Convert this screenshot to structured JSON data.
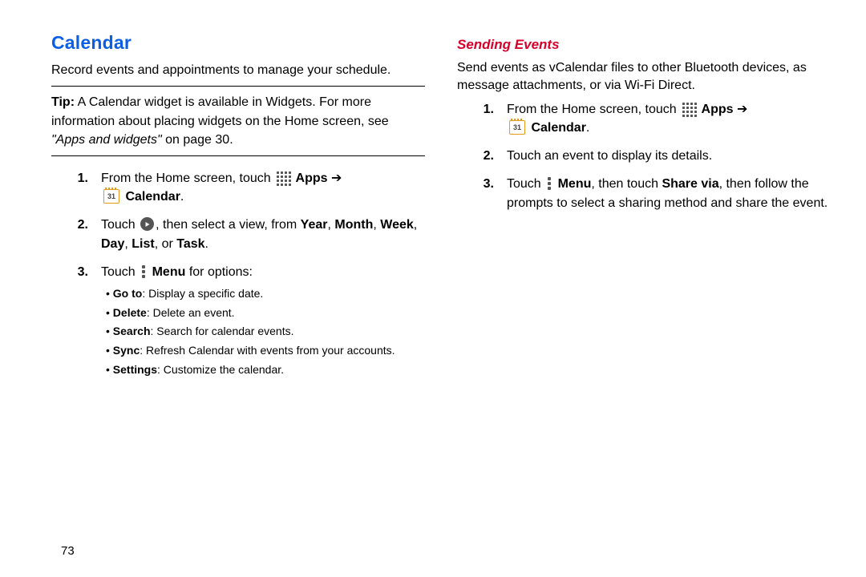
{
  "page_number": "73",
  "left": {
    "heading": "Calendar",
    "intro": "Record events and appointments to manage your schedule.",
    "tip": {
      "label": "Tip:",
      "body_before_quote": " A Calendar widget is available in Widgets. For more information about placing widgets on the Home screen, see ",
      "quote": "\"Apps and widgets\"",
      "body_after_quote": " on page 30."
    },
    "steps": [
      {
        "num": "1.",
        "pre": "From the Home screen, touch ",
        "apps_label": "Apps",
        "arrow": " ➔ ",
        "cal_day": "31",
        "cal_label": "Calendar",
        "post": "."
      },
      {
        "num": "2.",
        "pre": "Touch ",
        "mid": ", then select a view, from ",
        "views": [
          "Year",
          "Month",
          "Week",
          "Day",
          "List",
          "Task"
        ],
        "post": "."
      },
      {
        "num": "3.",
        "pre": "Touch ",
        "menu_label": "Menu",
        "post": " for options:",
        "bullets": [
          {
            "label": "Go to",
            "text": ": Display a specific date."
          },
          {
            "label": "Delete",
            "text": ": Delete an event."
          },
          {
            "label": "Search",
            "text": ": Search for calendar events."
          },
          {
            "label": "Sync",
            "text": ": Refresh Calendar with events from your accounts."
          },
          {
            "label": "Settings",
            "text": ": Customize the calendar."
          }
        ]
      }
    ]
  },
  "right": {
    "heading": "Sending Events",
    "intro": "Send events as vCalendar files to other Bluetooth devices, as message attachments, or via Wi-Fi Direct.",
    "steps": [
      {
        "num": "1.",
        "pre": "From the Home screen, touch ",
        "apps_label": "Apps",
        "arrow": " ➔ ",
        "cal_day": "31",
        "cal_label": "Calendar",
        "post": "."
      },
      {
        "num": "2.",
        "text": "Touch an event to display its details."
      },
      {
        "num": "3.",
        "pre": "Touch ",
        "menu_label": "Menu",
        "mid": ", then touch ",
        "share_label": "Share via",
        "post": ", then follow the prompts to select a sharing method and share the event."
      }
    ]
  }
}
